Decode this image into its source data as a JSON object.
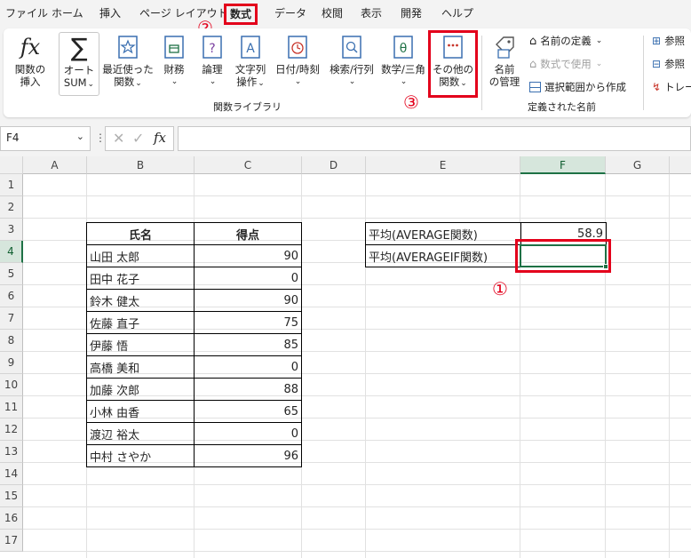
{
  "tabs": [
    "ファイル",
    "ホーム",
    "挿入",
    "ページ レイアウト",
    "数式",
    "データ",
    "校閲",
    "表示",
    "開発",
    "ヘルプ"
  ],
  "ribbon": {
    "insert_function": [
      "関数の",
      "挿入"
    ],
    "autosum": [
      "オート",
      "SUM"
    ],
    "recent": [
      "最近使った",
      "関数"
    ],
    "financial": "財務",
    "logical": "論理",
    "text": [
      "文字列",
      "操作"
    ],
    "datetime": "日付/時刻",
    "lookup": "検索/行列",
    "math": "数学/三角",
    "more_functions": [
      "その他の",
      "関数"
    ],
    "name_manager": [
      "名前",
      "の管理"
    ],
    "define_name": "名前の定義",
    "use_in_formula": "数式で使用",
    "create_from_selection": "選択範囲から作成",
    "trace_precedents": "参照",
    "trace_dependents": "参照",
    "remove_arrows": "トレー",
    "group_function_library": "関数ライブラリ",
    "group_defined_names": "定義された名前"
  },
  "annotations": {
    "step1": "①",
    "step2": "②",
    "step3": "③"
  },
  "formula_bar": {
    "name_box": "F4",
    "formula": ""
  },
  "columns": [
    "A",
    "B",
    "C",
    "D",
    "E",
    "F",
    "G"
  ],
  "rows": [
    "1",
    "2",
    "3",
    "4",
    "5",
    "6",
    "7",
    "8",
    "9",
    "10",
    "11",
    "12",
    "13",
    "14",
    "15",
    "16",
    "17"
  ],
  "table": {
    "headers": [
      "氏名",
      "得点"
    ],
    "rows": [
      [
        "山田 太郎",
        "90"
      ],
      [
        "田中 花子",
        "0"
      ],
      [
        "鈴木 健太",
        "90"
      ],
      [
        "佐藤 直子",
        "75"
      ],
      [
        "伊藤 悟",
        "85"
      ],
      [
        "高橋 美和",
        "0"
      ],
      [
        "加藤 次郎",
        "88"
      ],
      [
        "小林 由香",
        "65"
      ],
      [
        "渡辺 裕太",
        "0"
      ],
      [
        "中村 さやか",
        "96"
      ]
    ]
  },
  "summary": [
    {
      "label": "平均(AVERAGE関数)",
      "value": "58.9"
    },
    {
      "label": "平均(AVERAGEIF関数)",
      "value": ""
    }
  ],
  "colors": {
    "accent": "#1e7145",
    "highlight": "#e3001b"
  }
}
